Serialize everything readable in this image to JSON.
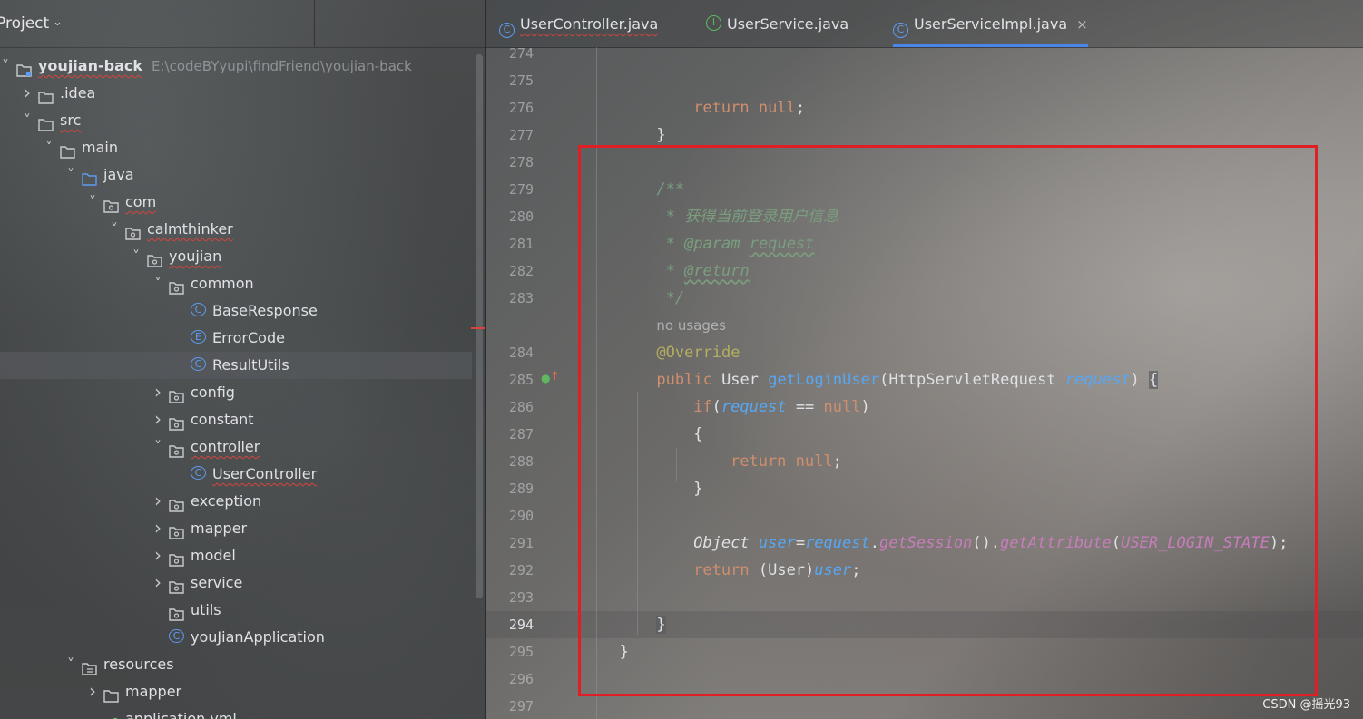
{
  "project": {
    "title": "Project",
    "root_name": "youjian-back",
    "root_path": "E:\\codeBYyupi\\findFriend\\youjian-back",
    "tree": [
      {
        "label": "youjian-back",
        "depth": 0,
        "arrow": "down",
        "icon": "module-folder-icon",
        "squiggle": true
      },
      {
        "label": ".idea",
        "depth": 1,
        "arrow": "right",
        "icon": "folder-icon"
      },
      {
        "label": "src",
        "depth": 1,
        "arrow": "down",
        "icon": "folder-icon",
        "squiggle": true
      },
      {
        "label": "main",
        "depth": 2,
        "arrow": "down",
        "icon": "folder-icon"
      },
      {
        "label": "java",
        "depth": 3,
        "arrow": "down",
        "icon": "source-folder-icon"
      },
      {
        "label": "com",
        "depth": 4,
        "arrow": "down",
        "icon": "package-icon",
        "squiggle": true
      },
      {
        "label": "calmthinker",
        "depth": 5,
        "arrow": "down",
        "icon": "package-icon",
        "squiggle": true
      },
      {
        "label": "youjian",
        "depth": 6,
        "arrow": "down",
        "icon": "package-icon",
        "squiggle": true
      },
      {
        "label": "common",
        "depth": 7,
        "arrow": "down",
        "icon": "package-icon"
      },
      {
        "label": "BaseResponse",
        "depth": 8,
        "arrow": "",
        "icon": "class-icon",
        "glyph": "C"
      },
      {
        "label": "ErrorCode",
        "depth": 8,
        "arrow": "",
        "icon": "enum-icon",
        "glyph": "E"
      },
      {
        "label": "ResultUtils",
        "depth": 8,
        "arrow": "",
        "icon": "class-icon",
        "glyph": "C",
        "selected": true
      },
      {
        "label": "config",
        "depth": 7,
        "arrow": "right",
        "icon": "package-icon"
      },
      {
        "label": "constant",
        "depth": 7,
        "arrow": "right",
        "icon": "package-icon"
      },
      {
        "label": "controller",
        "depth": 7,
        "arrow": "down",
        "icon": "package-icon",
        "squiggle": true
      },
      {
        "label": "UserController",
        "depth": 8,
        "arrow": "",
        "icon": "class-icon",
        "glyph": "C",
        "squiggle": true
      },
      {
        "label": "exception",
        "depth": 7,
        "arrow": "right",
        "icon": "package-icon"
      },
      {
        "label": "mapper",
        "depth": 7,
        "arrow": "right",
        "icon": "package-icon"
      },
      {
        "label": "model",
        "depth": 7,
        "arrow": "right",
        "icon": "package-icon"
      },
      {
        "label": "service",
        "depth": 7,
        "arrow": "right",
        "icon": "package-icon"
      },
      {
        "label": "utils",
        "depth": 7,
        "arrow": "",
        "icon": "package-icon"
      },
      {
        "label": "youJianApplication",
        "depth": 7,
        "arrow": "",
        "icon": "spring-class-icon",
        "glyph": "C"
      },
      {
        "label": "resources",
        "depth": 3,
        "arrow": "down",
        "icon": "resources-folder-icon"
      },
      {
        "label": "mapper",
        "depth": 4,
        "arrow": "right",
        "icon": "folder-icon"
      },
      {
        "label": "application.yml",
        "depth": 4,
        "arrow": "",
        "icon": "yaml-icon"
      }
    ]
  },
  "tabs": [
    {
      "label": "UserController.java",
      "icon": "class-icon",
      "glyph": "C",
      "squiggle": true
    },
    {
      "label": "UserService.java",
      "icon": "interface-icon",
      "glyph": "I"
    },
    {
      "label": "UserServiceImpl.java",
      "icon": "class-icon",
      "glyph": "C",
      "active": true,
      "close": "×"
    }
  ],
  "editor": {
    "current_line": "294",
    "hint_no_usages": "no usages",
    "lines": [
      {
        "num": "274"
      },
      {
        "num": "275"
      },
      {
        "num": "276",
        "kind": "return-null-1"
      },
      {
        "num": "277",
        "kind": "close-brace-1"
      },
      {
        "num": "278"
      },
      {
        "num": "279",
        "kind": "doc-open"
      },
      {
        "num": "280",
        "kind": "doc-desc"
      },
      {
        "num": "281",
        "kind": "doc-param"
      },
      {
        "num": "282",
        "kind": "doc-return"
      },
      {
        "num": "283",
        "kind": "doc-close"
      },
      {
        "num": "",
        "kind": "hint"
      },
      {
        "num": "284",
        "kind": "override"
      },
      {
        "num": "285",
        "kind": "signature"
      },
      {
        "num": "286",
        "kind": "if"
      },
      {
        "num": "287",
        "kind": "open-brace"
      },
      {
        "num": "288",
        "kind": "return-null-2"
      },
      {
        "num": "289",
        "kind": "close-brace-2"
      },
      {
        "num": "290"
      },
      {
        "num": "291",
        "kind": "object-line"
      },
      {
        "num": "292",
        "kind": "return-user"
      },
      {
        "num": "293"
      },
      {
        "num": "294",
        "kind": "close-brace-3"
      },
      {
        "num": "295",
        "kind": "class-close"
      },
      {
        "num": "296"
      },
      {
        "num": "297"
      }
    ],
    "tokens": {
      "return_kw": "return",
      "null_kw": "null",
      "semicolon": ";",
      "public_kw": "public",
      "if_kw": "if",
      "doc_open": "/**",
      "doc_desc": "* 获得当前登录用户信息",
      "doc_star": "* ",
      "doc_param_tag": "@param",
      "doc_param_name": "request",
      "doc_return_tag": "@return",
      "doc_close": "*/",
      "override": "@Override",
      "type_user": "User",
      "method_name": "getLoginUser",
      "param_type": "HttpServletRequest",
      "param_name": "request",
      "object_type": "Object",
      "var_user": "user",
      "get_session": "getSession",
      "get_attribute": "getAttribute",
      "const_name": "USER_LOGIN_STATE"
    }
  },
  "watermark": "CSDN @摇光93",
  "colors": {
    "highlight_box": "#e01e25",
    "keyword": "#cf8e6d",
    "comment": "#7a9e7e",
    "annotation": "#b3ae60",
    "parameter": "#56a8f5",
    "method": "#c77dbb"
  }
}
